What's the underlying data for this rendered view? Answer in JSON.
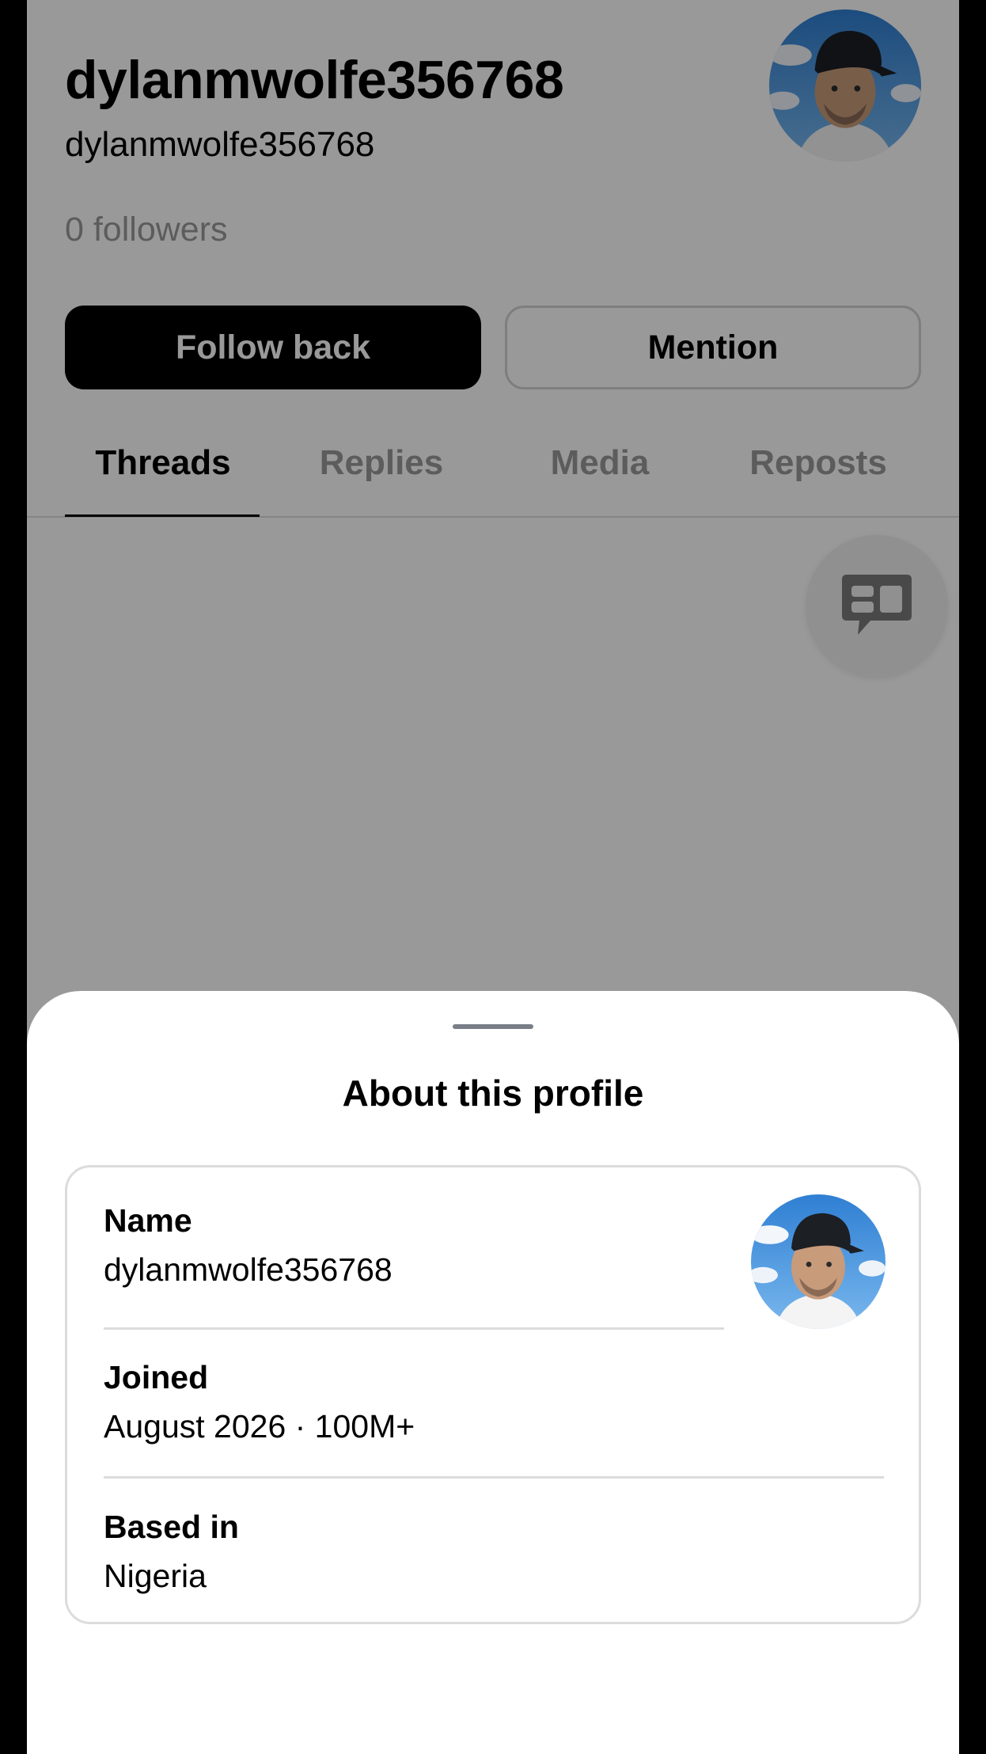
{
  "profile": {
    "display_name": "dylanmwolfe356768",
    "handle": "dylanmwolfe356768",
    "followers": "0 followers",
    "follow_back_label": "Follow back",
    "mention_label": "Mention",
    "tabs": [
      {
        "label": "Threads",
        "active": true
      },
      {
        "label": "Replies",
        "active": false
      },
      {
        "label": "Media",
        "active": false
      },
      {
        "label": "Reposts",
        "active": false
      }
    ],
    "fab_icon": "message-board-icon"
  },
  "sheet": {
    "title": "About this profile",
    "rows": [
      {
        "label": "Name",
        "value": "dylanmwolfe356768"
      },
      {
        "label": "Joined",
        "value": "August 2026 · 100M+"
      },
      {
        "label": "Based in",
        "value": "Nigeria"
      }
    ]
  },
  "colors": {
    "scrim": "rgba(0,0,0,0.4)",
    "primary_button": "#000000",
    "muted_text": "#999999",
    "divider": "#dcdcdc"
  }
}
